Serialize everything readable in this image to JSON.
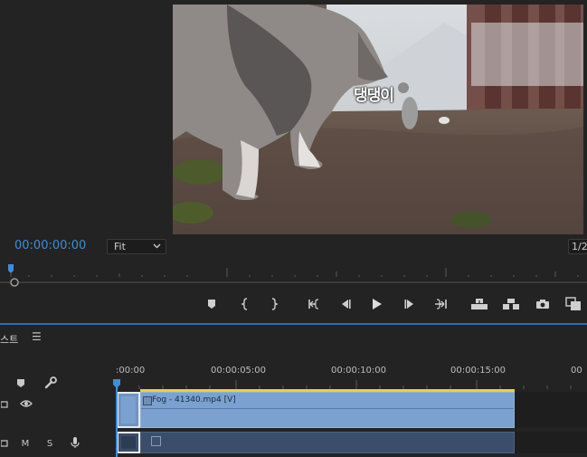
{
  "monitor": {
    "caption": "댕댕이",
    "timecode": "00:00:00:00",
    "zoom_select": "Fit",
    "resolution": "1/2"
  },
  "controls": [
    {
      "name": "add-marker-button",
      "icon": "marker-icon"
    },
    {
      "name": "mark-in-button",
      "icon": "mark-in-icon"
    },
    {
      "name": "mark-out-button",
      "icon": "mark-out-icon"
    },
    {
      "name": "go-to-in-button",
      "icon": "go-to-in-icon"
    },
    {
      "name": "step-back-button",
      "icon": "step-back-icon"
    },
    {
      "name": "play-button",
      "icon": "play-icon"
    },
    {
      "name": "step-forward-button",
      "icon": "step-forward-icon"
    },
    {
      "name": "go-to-out-button",
      "icon": "go-to-out-icon"
    },
    {
      "name": "lift-button",
      "icon": "lift-icon"
    },
    {
      "name": "extract-button",
      "icon": "extract-icon"
    },
    {
      "name": "export-frame-button",
      "icon": "camera-icon"
    },
    {
      "name": "compare-view-button",
      "icon": "compare-icon"
    }
  ],
  "timeline": {
    "tab_label": "스트",
    "ruler_labels": [
      ":00:00",
      "00:00:05:00",
      "00:00:10:00",
      "00:00:15:00",
      "00"
    ],
    "video_clip": {
      "title": "Fog - 41340.mp4 [V]"
    },
    "audio_track": {
      "mute_label": "M",
      "solo_label": "S"
    }
  },
  "colors": {
    "accent": "#3e8ed8",
    "video_clip": "#7aa1d0",
    "audio_clip": "#3a4e6c",
    "work_area": "#e6d23a"
  }
}
